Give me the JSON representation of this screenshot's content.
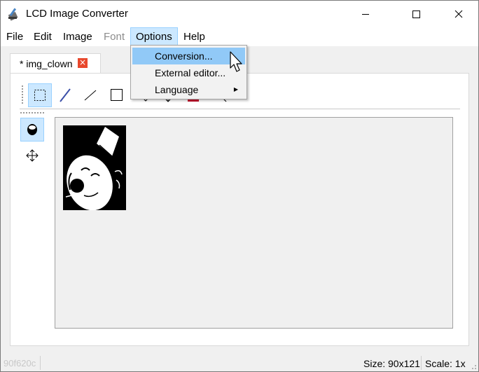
{
  "window": {
    "title": "LCD Image Converter",
    "minimize_icon": "minimize-icon",
    "maximize_icon": "maximize-icon",
    "close_icon": "close-icon"
  },
  "menubar": {
    "items": [
      {
        "label": "File",
        "state": "normal"
      },
      {
        "label": "Edit",
        "state": "normal"
      },
      {
        "label": "Image",
        "state": "normal"
      },
      {
        "label": "Font",
        "state": "disabled"
      },
      {
        "label": "Options",
        "state": "active"
      },
      {
        "label": "Help",
        "state": "normal"
      }
    ]
  },
  "options_menu": {
    "items": [
      {
        "label": "Conversion...",
        "highlighted": true,
        "submenu": false
      },
      {
        "label": "External editor...",
        "highlighted": false,
        "submenu": false
      },
      {
        "label": "Language",
        "highlighted": false,
        "submenu": true
      }
    ]
  },
  "tab": {
    "label": "* img_clown",
    "close_icon": "close-icon"
  },
  "toolbar": {
    "tools": [
      {
        "name": "select-rect-icon",
        "selected": true
      },
      {
        "name": "pen-icon",
        "selected": false
      },
      {
        "name": "line-icon",
        "selected": false
      },
      {
        "name": "rectangle-icon",
        "selected": false
      }
    ]
  },
  "side_tools": [
    {
      "name": "fill-mode-icon",
      "selected": true
    },
    {
      "name": "move-icon",
      "selected": false
    }
  ],
  "statusbar": {
    "left_text": "90f620c",
    "size": "Size: 90x121",
    "scale": "Scale: 1x"
  },
  "colors": {
    "menu_active_bg": "#cce8ff",
    "menu_highlight_bg": "#91c9f7",
    "close_badge": "#e8482d",
    "canvas_bg": "#f0f0f0"
  }
}
